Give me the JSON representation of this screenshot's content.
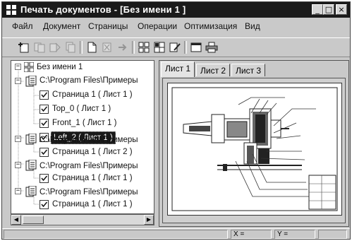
{
  "window": {
    "title": "Печать документов - [Без имени 1 ]"
  },
  "menu": [
    "Файл",
    "Документ",
    "Страницы",
    "Операции",
    "Оптимизация",
    "Вид"
  ],
  "toolbar": {
    "icons": [
      "add-document-icon",
      "copy-document-icon",
      "document-pair-icon",
      "document-stack-icon",
      "blank-page-icon",
      "delete-page-icon",
      "export-icon",
      "grid-layout-icon",
      "grid-alt-icon",
      "pencil-icon",
      "window-icon",
      "printer-icon"
    ]
  },
  "tree": {
    "root": "Без имени 1",
    "items": [
      {
        "path": "C:\\Program Files\\Примеры",
        "pages": [
          "Страница 1 ( Лист 1 )",
          "Top_0 ( Лист 1 )",
          "Front_1 ( Лист 1 )",
          "Left_2 ( Лист 1 )"
        ],
        "selected_page": "Left_2 ( Лист 1 )"
      },
      {
        "path": "C:\\Program Files\\Примеры",
        "pages": [
          "Страница 1 ( Лист 2 )"
        ]
      },
      {
        "path": "C:\\Program Files\\Примеры",
        "pages": [
          "Страница 1 ( Лист 1 )"
        ]
      },
      {
        "path": "C:\\Program Files\\Примеры",
        "pages": [
          "Страница 1 ( Лист 1 )"
        ]
      }
    ]
  },
  "tabs": [
    "Лист 1",
    "Лист 2",
    "Лист 3"
  ],
  "active_tab": "Лист 1",
  "status": {
    "x_label": "X =",
    "y_label": "Y ="
  },
  "colors": {
    "titlebar": "#1a1a1a",
    "window": "#c9c9c9",
    "selection": "#1a1a1a"
  }
}
